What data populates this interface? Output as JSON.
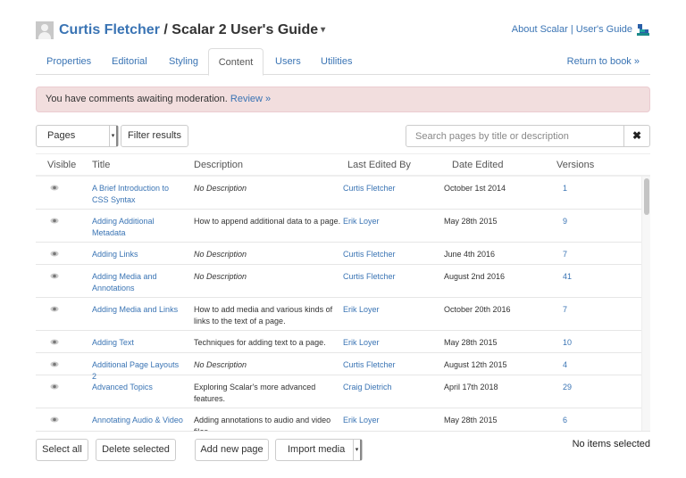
{
  "header": {
    "user_name": "Curtis Fletcher",
    "separator": " / ",
    "book_title": "Scalar 2 User's Guide",
    "book_caret": "▾",
    "about_link": "About Scalar",
    "links_separator": " | ",
    "guide_link": "User's Guide",
    "logo_icon": "scalar-logo-icon"
  },
  "tabs": [
    {
      "label": "Properties",
      "active": false
    },
    {
      "label": "Editorial",
      "active": false
    },
    {
      "label": "Styling",
      "active": false
    },
    {
      "label": "Content",
      "active": true
    },
    {
      "label": "Users",
      "active": false
    },
    {
      "label": "Utilities",
      "active": false
    }
  ],
  "return_link": "Return to book »",
  "alert": {
    "message": "You have comments awaiting moderation. ",
    "link": "Review »"
  },
  "controls": {
    "type_select_value": "Pages",
    "type_select_arrow": "▾",
    "filter_button": "Filter results",
    "search_placeholder": "Search pages by title or description",
    "search_value": "",
    "clear_icon": "✖"
  },
  "table": {
    "columns": [
      "Visible",
      "Title",
      "Description",
      "Last Edited By",
      "Date Edited",
      "Versions"
    ],
    "rows": [
      {
        "visible_icon": "eye-icon",
        "title": "A Brief Introduction to CSS Syntax",
        "description": "No Description",
        "description_placeholder": true,
        "editor": "Curtis Fletcher",
        "date": "October 1st 2014",
        "versions": "1"
      },
      {
        "visible_icon": "eye-icon",
        "title": "Adding Additional Metadata",
        "description": "How to append additional data to a page.",
        "description_placeholder": false,
        "editor": "Erik Loyer",
        "date": "May 28th 2015",
        "versions": "9"
      },
      {
        "visible_icon": "eye-icon",
        "title": "Adding Links",
        "description": "No Description",
        "description_placeholder": true,
        "editor": "Curtis Fletcher",
        "date": "June 4th 2016",
        "versions": "7"
      },
      {
        "visible_icon": "eye-icon",
        "title": "Adding Media and Annotations",
        "description": "No Description",
        "description_placeholder": true,
        "editor": "Curtis Fletcher",
        "date": "August 2nd 2016",
        "versions": "41"
      },
      {
        "visible_icon": "eye-icon",
        "title": "Adding Media and Links",
        "description": "How to add media and various kinds of links to the text of a page.",
        "description_placeholder": false,
        "editor": "Erik Loyer",
        "date": "October 20th 2016",
        "versions": "7"
      },
      {
        "visible_icon": "eye-icon",
        "title": "Adding Text",
        "description": "Techniques for adding text to a page.",
        "description_placeholder": false,
        "editor": "Erik Loyer",
        "date": "May 28th 2015",
        "versions": "10"
      },
      {
        "visible_icon": "eye-icon",
        "title": "Additional Page Layouts 2",
        "description": "No Description",
        "description_placeholder": true,
        "editor": "Curtis Fletcher",
        "date": "August 12th 2015",
        "versions": "4"
      },
      {
        "visible_icon": "eye-icon",
        "title": "Advanced Topics",
        "description": "Exploring Scalar's more advanced features.",
        "description_placeholder": false,
        "editor": "Craig Dietrich",
        "date": "April 17th 2018",
        "versions": "29"
      },
      {
        "visible_icon": "eye-icon",
        "title": "Annotating Audio & Video",
        "description": "Adding annotations to audio and video files.",
        "description_placeholder": false,
        "editor": "Erik Loyer",
        "date": "May 28th 2015",
        "versions": "6"
      }
    ]
  },
  "footer": {
    "select_all": "Select all",
    "delete_selected": "Delete selected",
    "add_new_page": "Add new page",
    "import_media": "Import media",
    "import_arrow": "▾",
    "status": "No items selected"
  },
  "colors": {
    "link": "#3a74b4",
    "alert_bg": "#f2dede",
    "logo_teal": "#1a8a8a",
    "logo_blue": "#2a5fa8"
  }
}
